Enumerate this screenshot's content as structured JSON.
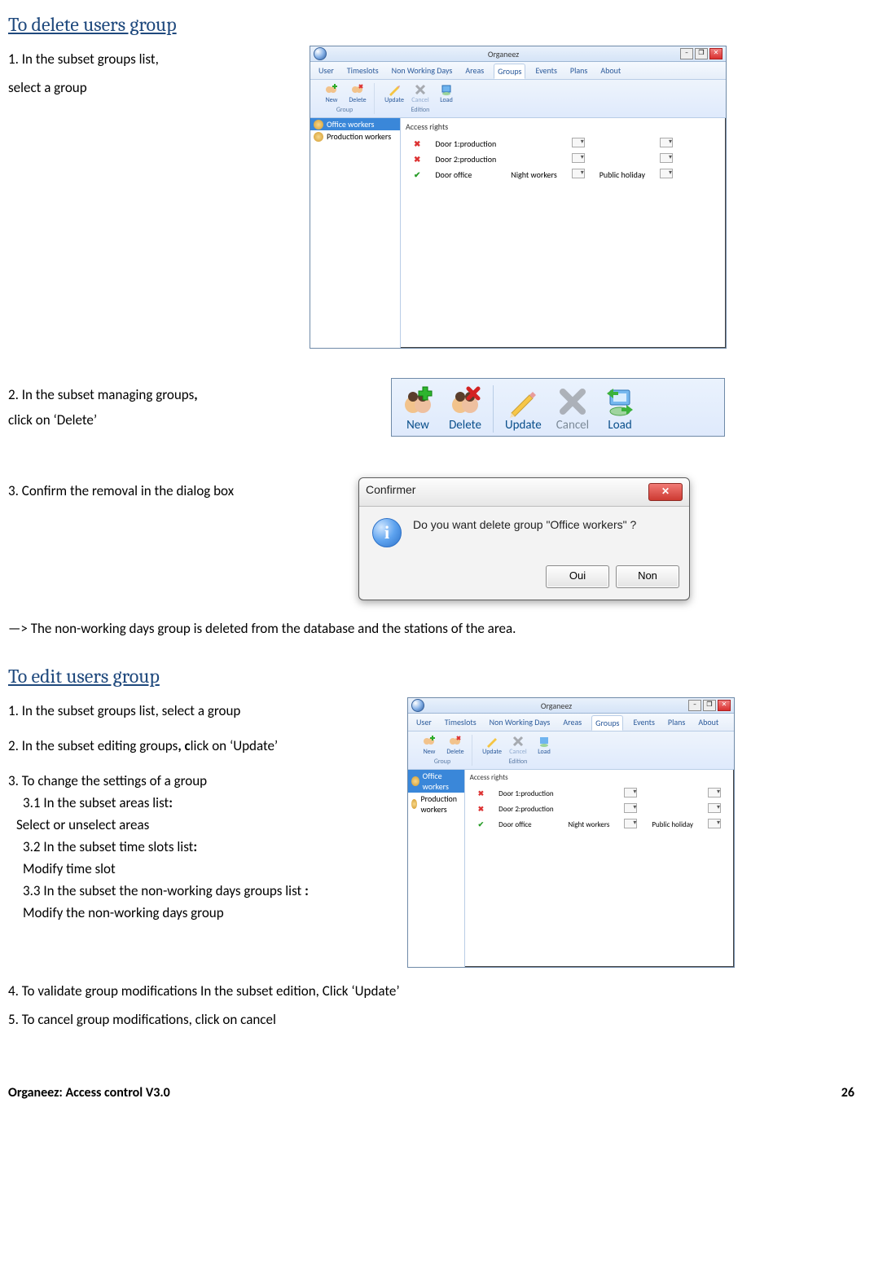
{
  "section_delete": {
    "heading": "To delete users group",
    "step1a": "1. In the subset groups list,",
    "step1b": "select a group",
    "step2a": "2. In the subset managing groups",
    "step2b": "click on ‘Delete’",
    "comma": ",",
    "step3": "3. Confirm the removal in the dialog box",
    "result": "—> The non-working days group is deleted from the database and the stations of the area."
  },
  "app_screenshot": {
    "title": "Organeez",
    "tabs": [
      "User",
      "Timeslots",
      "Non Working Days",
      "Areas",
      "Groups",
      "Events",
      "Plans",
      "About"
    ],
    "active_tab_index": 4,
    "ribbon": {
      "group1_label": "Group",
      "group2_label": "Edition",
      "buttons1": [
        {
          "key": "new",
          "label": "New"
        },
        {
          "key": "delete",
          "label": "Delete"
        }
      ],
      "buttons2": [
        {
          "key": "update",
          "label": "Update"
        },
        {
          "key": "cancel",
          "label": "Cancel",
          "disabled": true
        },
        {
          "key": "load",
          "label": "Load"
        }
      ]
    },
    "side_items": [
      {
        "label": "Office workers",
        "selected": true
      },
      {
        "label": "Production workers",
        "selected": false
      }
    ],
    "rights_header": "Access rights",
    "rights": [
      {
        "mark": "x",
        "door": "Door 1:production",
        "slot": "",
        "cal": ""
      },
      {
        "mark": "x",
        "door": "Door 2:production",
        "slot": "",
        "cal": ""
      },
      {
        "mark": "v",
        "door": "Door office",
        "slot": "Night workers",
        "cal": "Public holiday"
      }
    ]
  },
  "toolbar_closeup": {
    "new": "New",
    "delete": "Delete",
    "update": "Update",
    "cancel": "Cancel",
    "load": "Load"
  },
  "dialog": {
    "title": "Confirmer",
    "message": "Do you want delete group \"Office workers\" ?",
    "yes": "Oui",
    "no": "Non"
  },
  "section_edit": {
    "heading": "To edit users group",
    "step1": "1. In the subset groups list, select a group",
    "step2a": "2. In the subset editing groups",
    "step2b_bold": ", c",
    "step2c": "lick on ‘Update’",
    "step3": "3. To change the settings of a group",
    "step3_1": "3.1 In the subset areas list",
    "step3_1_colon": ":",
    "step3_1_b": "Select or unselect areas",
    "step3_2": "3.2 In the subset time slots list",
    "step3_2_colon": ":",
    "step3_2_b": "Modify time slot",
    "step3_3": "3.3 In the subset the non-working days groups list ",
    "step3_3_colon": ":",
    "step3_3_b": "Modify the non-working days group",
    "step4": "4. To validate group modifications In the subset edition, Click ‘Update’",
    "step5": "5. To cancel group modifications, click on cancel"
  },
  "footer": {
    "left": "Organeez: Access control     V3.0",
    "right": "26"
  }
}
